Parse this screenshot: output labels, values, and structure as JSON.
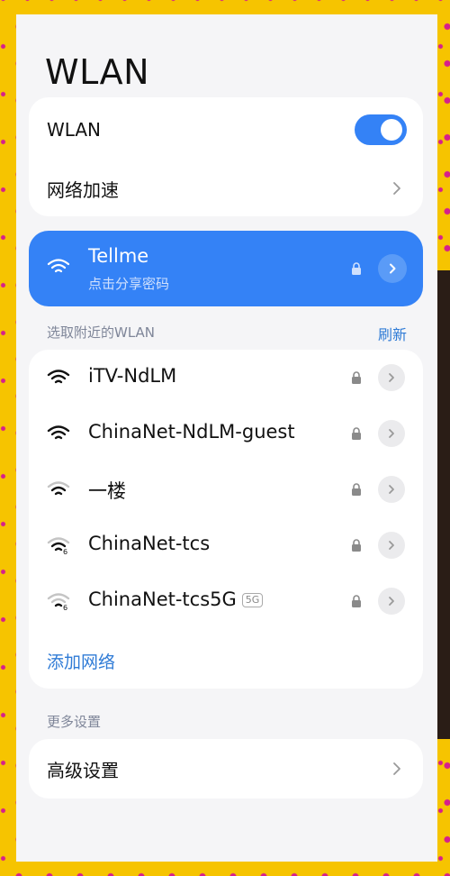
{
  "colors": {
    "accent": "#3482f6",
    "link": "#2f7bd6",
    "background_yellow": "#f6c400",
    "background_magenta": "#d61f8c"
  },
  "page": {
    "title": "WLAN"
  },
  "top_card": {
    "wlan_label": "WLAN",
    "wlan_toggle_on": true,
    "network_accel_label": "网络加速"
  },
  "connected": {
    "name": "Tellme",
    "subtitle": "点击分享密码",
    "icons": {
      "wifi": "wifi-icon",
      "lock": "lock-icon",
      "detail": "chevron-right-icon"
    }
  },
  "nearby": {
    "section_label": "选取附近的WLAN",
    "refresh_label": "刷新",
    "networks": [
      {
        "name": "iTV-NdLM",
        "signal": "full",
        "badge": ""
      },
      {
        "name": "ChinaNet-NdLM-guest",
        "signal": "full",
        "badge": ""
      },
      {
        "name": "一楼",
        "signal": "medium",
        "badge": ""
      },
      {
        "name": "ChinaNet-tcs",
        "signal": "medium-6",
        "badge": ""
      },
      {
        "name": "ChinaNet-tcs5G",
        "signal": "weak-6",
        "badge": "5G"
      }
    ],
    "add_network_label": "添加网络"
  },
  "more": {
    "section_label": "更多设置",
    "advanced_label": "高级设置"
  }
}
